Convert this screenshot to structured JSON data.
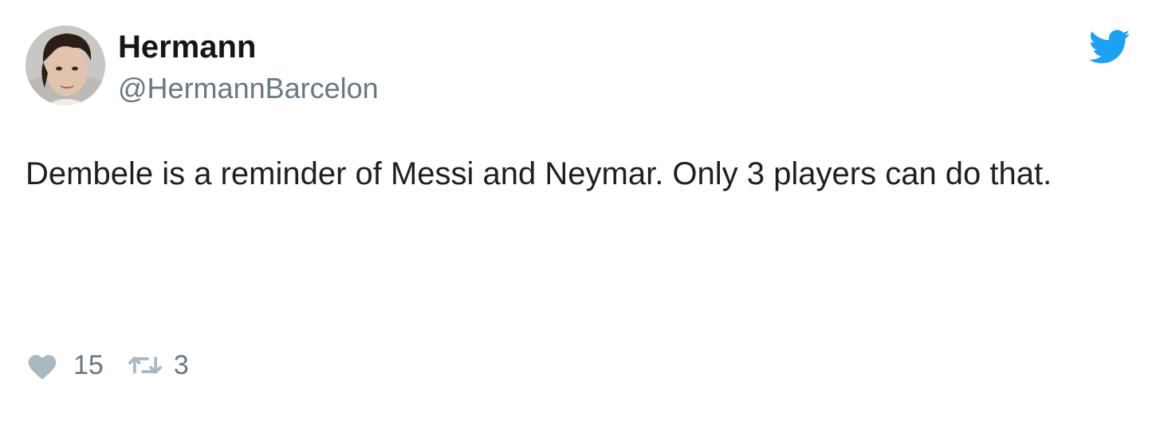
{
  "user": {
    "display_name": "Hermann",
    "handle": "@HermannBarcelon"
  },
  "tweet": {
    "text": "Dembele is a reminder of Messi and Neymar. Only 3 players can do that."
  },
  "actions": {
    "like_count": "15",
    "retweet_count": "3"
  },
  "icons": {
    "brand": "twitter-bird-icon",
    "like": "heart-icon",
    "retweet": "retweet-icon"
  },
  "colors": {
    "brand_blue": "#1da1f2",
    "muted_gray": "#697882",
    "icon_gray": "#aab8c2",
    "text": "#1c2022"
  }
}
